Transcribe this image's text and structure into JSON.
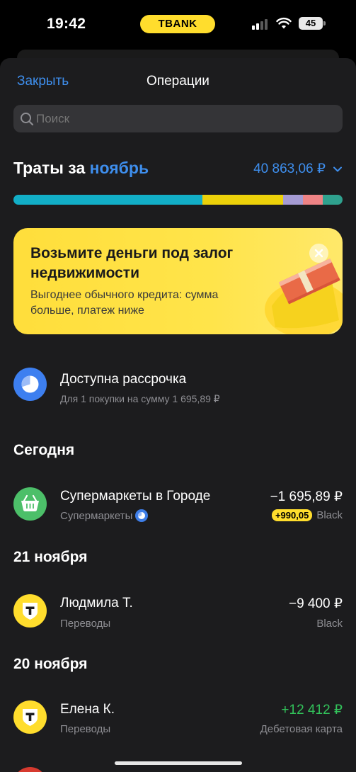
{
  "status_bar": {
    "time": "19:42",
    "bank_pill": "TBANK",
    "battery": "45"
  },
  "nav": {
    "close_label": "Закрыть",
    "title": "Операции"
  },
  "search": {
    "placeholder": "Поиск"
  },
  "spending": {
    "title_prefix": "Траты за ",
    "month": "ноябрь",
    "total": "40 863,06 ₽",
    "segments": [
      {
        "color": "#12aec7",
        "fraction": 0.575
      },
      {
        "color": "#ecd10a",
        "fraction": 0.245
      },
      {
        "color": "#a59bd3",
        "fraction": 0.06
      },
      {
        "color": "#ee8385",
        "fraction": 0.06
      },
      {
        "color": "#2fa18e",
        "fraction": 0.06
      }
    ]
  },
  "promo": {
    "title": "Возьмите деньги под залог недвижимости",
    "subtitle": "Выгоднее обычного кредита: сумма больше, платеж ниже"
  },
  "installment": {
    "title": "Доступна рассрочка",
    "subtitle": "Для 1 покупки на сумму 1 695,89 ₽"
  },
  "sections": [
    {
      "header": "Сегодня",
      "operations": [
        {
          "title": "Супермаркеты в Городе",
          "category": "Супермаркеты",
          "amount": "−1 695,89 ₽",
          "cashback": "+990,05",
          "card": "Black"
        }
      ]
    },
    {
      "header": "21 ноября",
      "operations": [
        {
          "title": "Людмила Т.",
          "category": "Переводы",
          "amount": "−9 400 ₽",
          "card": "Black"
        }
      ]
    },
    {
      "header": "20 ноября",
      "operations": [
        {
          "title": "Елена К.",
          "category": "Переводы",
          "amount": "+12 412 ₽",
          "card": "Дебетовая карта"
        }
      ]
    }
  ],
  "colors": {
    "accent_blue": "#3e8eed",
    "brand_yellow": "#ffdd2d",
    "income_green": "#32c25a",
    "supermarket_green": "#4cbf69"
  }
}
